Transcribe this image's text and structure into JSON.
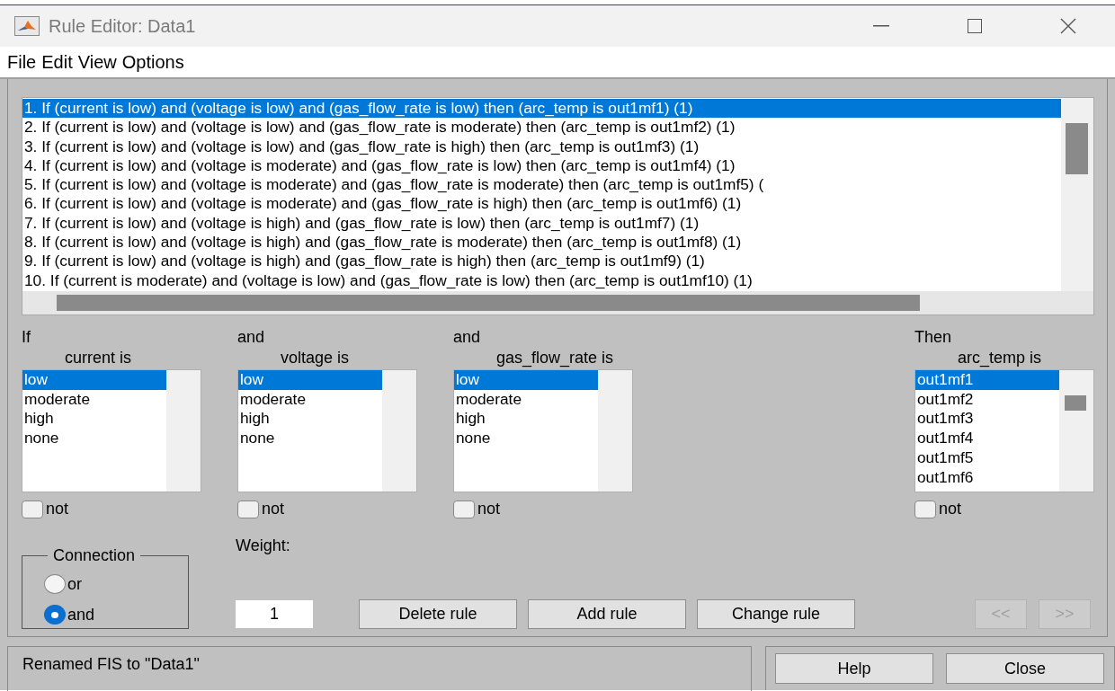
{
  "window": {
    "title": "Rule Editor: Data1"
  },
  "menu": [
    "File",
    "Edit",
    "View",
    "Options"
  ],
  "rules": [
    {
      "text": "1. If (current is low) and (voltage is low) and (gas_flow_rate is low) then (arc_temp is out1mf1) (1)",
      "selected": true
    },
    {
      "text": "2. If (current is low) and (voltage is low) and (gas_flow_rate is moderate) then (arc_temp is out1mf2) (1)",
      "selected": false
    },
    {
      "text": "3. If (current is low) and (voltage is low) and (gas_flow_rate is high) then (arc_temp is out1mf3) (1)",
      "selected": false
    },
    {
      "text": "4. If (current is low) and (voltage is moderate) and (gas_flow_rate is low) then (arc_temp is out1mf4) (1)",
      "selected": false
    },
    {
      "text": "5. If (current is low) and (voltage is moderate) and (gas_flow_rate is moderate) then (arc_temp is out1mf5) (",
      "selected": false
    },
    {
      "text": "6. If (current is low) and (voltage is moderate) and (gas_flow_rate is high) then (arc_temp is out1mf6) (1)",
      "selected": false
    },
    {
      "text": "7. If (current is low) and (voltage is high) and (gas_flow_rate is low) then (arc_temp is out1mf7) (1)",
      "selected": false
    },
    {
      "text": "8. If (current is low) and (voltage is high) and (gas_flow_rate is moderate) then (arc_temp is out1mf8) (1)",
      "selected": false
    },
    {
      "text": "9. If (current is low) and (voltage is high) and (gas_flow_rate is high) then (arc_temp is out1mf9) (1)",
      "selected": false
    },
    {
      "text": "10. If (current is moderate) and (voltage is low) and (gas_flow_rate is low) then (arc_temp is out1mf10) (1)",
      "selected": false
    }
  ],
  "columns": [
    {
      "connector": "If",
      "label": "current is",
      "items": [
        {
          "label": "low",
          "selected": true
        },
        {
          "label": "moderate",
          "selected": false
        },
        {
          "label": "high",
          "selected": false
        },
        {
          "label": "none",
          "selected": false
        }
      ],
      "scroll_thumb": false,
      "not_label": "not",
      "not_checked": false
    },
    {
      "connector": "and",
      "label": "voltage is",
      "items": [
        {
          "label": "low",
          "selected": true
        },
        {
          "label": "moderate",
          "selected": false
        },
        {
          "label": "high",
          "selected": false
        },
        {
          "label": "none",
          "selected": false
        }
      ],
      "scroll_thumb": false,
      "not_label": "not",
      "not_checked": false
    },
    {
      "connector": "and",
      "label": "gas_flow_rate is",
      "items": [
        {
          "label": "low",
          "selected": true
        },
        {
          "label": "moderate",
          "selected": false
        },
        {
          "label": "high",
          "selected": false
        },
        {
          "label": "none",
          "selected": false
        }
      ],
      "scroll_thumb": false,
      "not_label": "not",
      "not_checked": false
    },
    {
      "connector": "Then",
      "label": "arc_temp is",
      "items": [
        {
          "label": "out1mf1",
          "selected": true
        },
        {
          "label": "out1mf2",
          "selected": false
        },
        {
          "label": "out1mf3",
          "selected": false
        },
        {
          "label": "out1mf4",
          "selected": false
        },
        {
          "label": "out1mf5",
          "selected": false
        },
        {
          "label": "out1mf6",
          "selected": false
        }
      ],
      "scroll_thumb": true,
      "not_label": "not",
      "not_checked": false
    }
  ],
  "connection": {
    "title": "Connection",
    "options": [
      {
        "label": "or",
        "selected": false
      },
      {
        "label": "and",
        "selected": true
      }
    ]
  },
  "weight": {
    "label": "Weight:",
    "value": "1"
  },
  "buttons": [
    {
      "label": "Delete rule",
      "disabled": false
    },
    {
      "label": "Add rule",
      "disabled": false
    },
    {
      "label": "Change rule",
      "disabled": false
    },
    {
      "label": "<<",
      "disabled": true
    },
    {
      "label": ">>",
      "disabled": true
    }
  ],
  "status": "Renamed FIS to \"Data1\"",
  "footer_buttons": [
    "Help",
    "Close"
  ]
}
